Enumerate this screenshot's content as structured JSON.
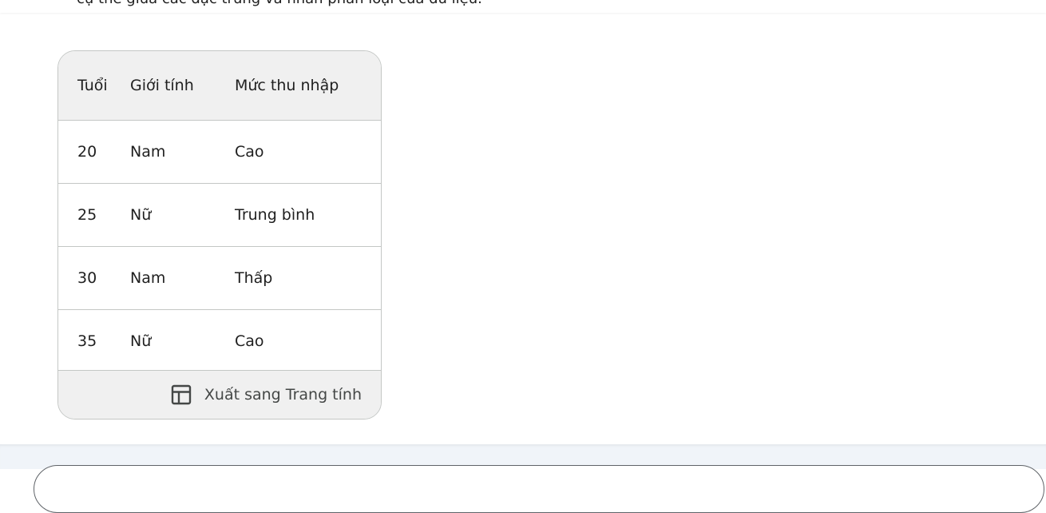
{
  "previous_text": "cụ thể giữa các đặc trưng và nhãn phân loại của dữ liệu.",
  "table": {
    "headers": [
      "Tuổi",
      "Giới tính",
      "Mức thu nhập"
    ],
    "rows": [
      [
        "20",
        "Nam",
        "Cao"
      ],
      [
        "25",
        "Nữ",
        "Trung bình"
      ],
      [
        "30",
        "Nam",
        "Thấp"
      ],
      [
        "35",
        "Nữ",
        "Cao"
      ]
    ]
  },
  "export": {
    "label": "Xuất sang Trang tính",
    "icon": "table-grid-icon"
  }
}
